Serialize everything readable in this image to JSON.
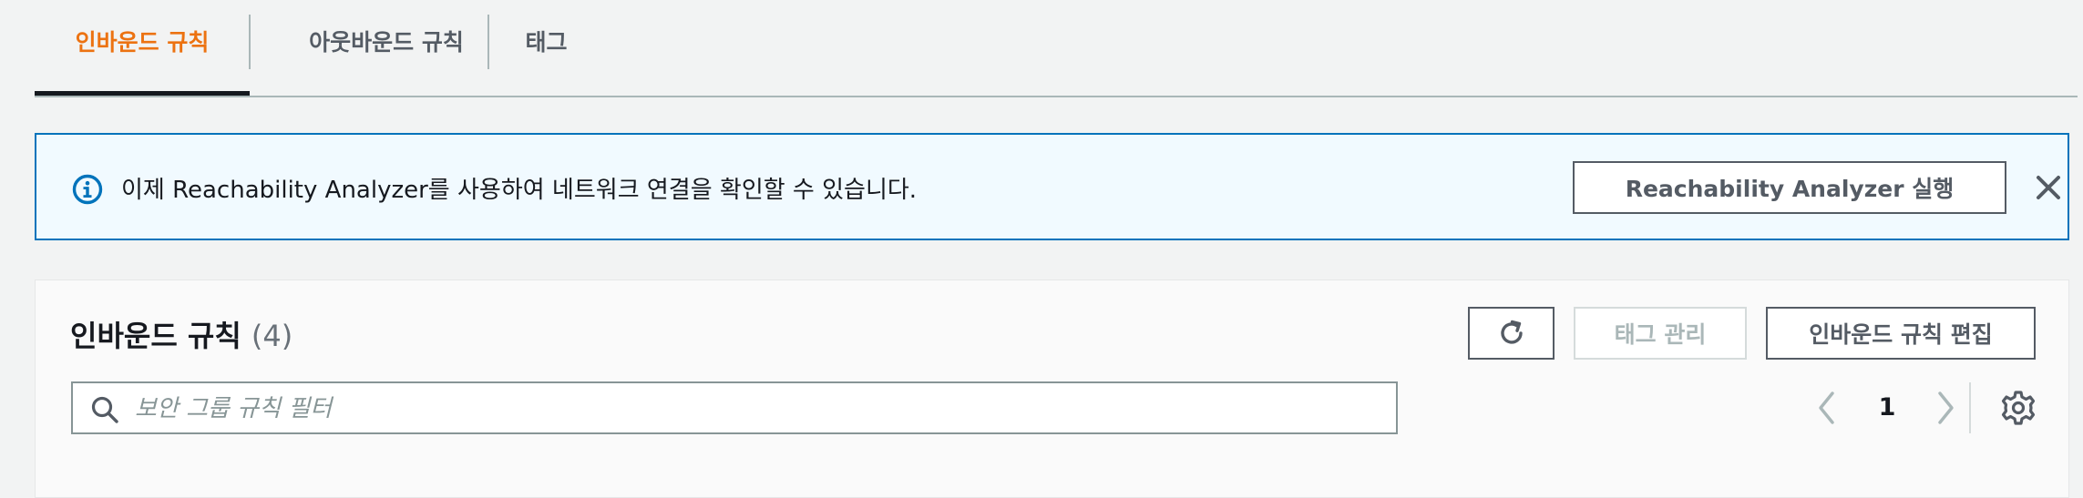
{
  "tabs": [
    {
      "label": "인바운드 규칙",
      "active": true
    },
    {
      "label": "아웃바운드 규칙",
      "active": false
    },
    {
      "label": "태그",
      "active": false
    }
  ],
  "banner": {
    "icon": "info-icon",
    "message": "이제 Reachability Analyzer를 사용하여 네트워크 연결을 확인할 수 있습니다.",
    "action_label": "Reachability Analyzer 실행",
    "close_icon": "close-icon"
  },
  "panel": {
    "title": "인바운드 규칙",
    "count": "(4)",
    "refresh_icon": "refresh-icon",
    "manage_tags_label": "태그 관리",
    "edit_rules_label": "인바운드 규칙 편집",
    "search": {
      "placeholder": "보안 그룹 규칙 필터",
      "value": ""
    },
    "pagination": {
      "current_page": "1"
    },
    "settings_icon": "gear-icon"
  },
  "colors": {
    "accent_orange": "#ec7211",
    "info_blue": "#0073bb",
    "banner_bg": "#f1faff",
    "text_dark": "#16191f",
    "text_muted": "#545b64",
    "disabled": "#aab7b8"
  }
}
